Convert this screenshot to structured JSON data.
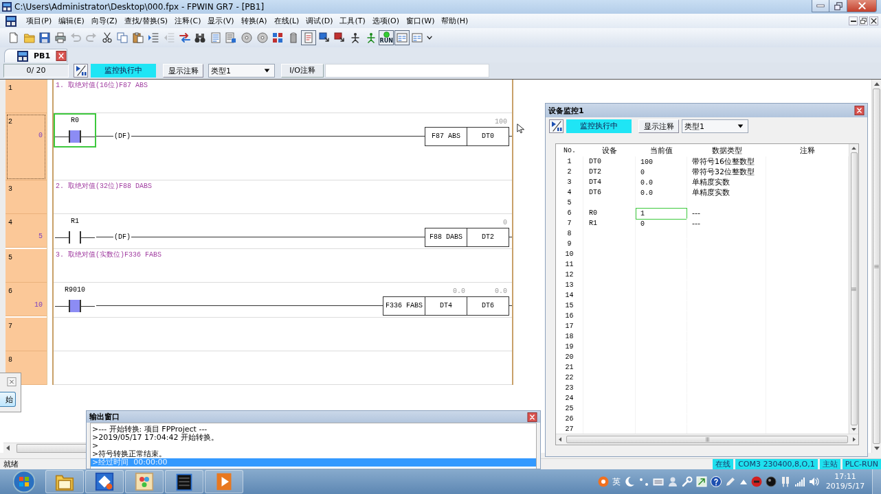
{
  "window": {
    "title": "C:\\Users\\Administrator\\Desktop\\000.fpx - FPWIN GR7 - [PB1]"
  },
  "menu": [
    "项目(P)",
    "编辑(E)",
    "向导(Z)",
    "查找/替换(S)",
    "注释(C)",
    "显示(V)",
    "转换(A)",
    "在线(L)",
    "调试(D)",
    "工具(T)",
    "选项(O)",
    "窗口(W)",
    "帮助(H)"
  ],
  "toolbar": [
    {
      "pressed": false,
      "disabled": false
    },
    {
      "pressed": false,
      "disabled": false
    },
    {
      "pressed": false,
      "disabled": false
    },
    {
      "pressed": false,
      "disabled": false
    },
    {
      "pressed": false,
      "disabled": true
    },
    {
      "pressed": false,
      "disabled": true
    },
    {
      "pressed": false,
      "disabled": false
    },
    {
      "pressed": false,
      "disabled": false
    },
    {
      "pressed": false,
      "disabled": false
    },
    {
      "pressed": false,
      "disabled": false
    },
    {
      "pressed": false,
      "disabled": true
    },
    {
      "pressed": false,
      "disabled": false
    },
    {
      "pressed": false,
      "disabled": false
    },
    {
      "pressed": false,
      "disabled": false
    },
    {
      "pressed": false,
      "disabled": false
    },
    {
      "pressed": false,
      "disabled": false
    },
    {
      "pressed": false,
      "disabled": false
    },
    {
      "pressed": false,
      "disabled": false
    },
    {
      "pressed": false,
      "disabled": false
    },
    {
      "pressed": true,
      "disabled": false
    },
    {
      "pressed": false,
      "disabled": false
    },
    {
      "pressed": false,
      "disabled": false
    },
    {
      "pressed": false,
      "disabled": false
    },
    {
      "pressed": false,
      "disabled": false
    },
    {
      "pressed": true,
      "disabled": false,
      "label": "RUN"
    },
    {
      "pressed": true,
      "disabled": false
    },
    {
      "pressed": false,
      "disabled": false
    }
  ],
  "document_tab": {
    "label": "PB1"
  },
  "program_bar": {
    "step_counter": "0/ 20",
    "monitor_status": "监控执行中",
    "comment_button": "显示注释",
    "type_select": "类型1",
    "io_label": "I/O注释"
  },
  "ladder": {
    "rows": [
      {
        "kind": "comment",
        "number": "1",
        "text": "1. 取绝对值(16位)F87 ABS",
        "selected": false
      },
      {
        "kind": "rung",
        "number": "2",
        "step": "0",
        "selected": true,
        "contact": {
          "device": "R0",
          "on": true,
          "selected": true
        },
        "edge": "(DF)",
        "cells": [
          {
            "text": "F87 ABS"
          },
          {
            "text": "DT0",
            "value": "100"
          }
        ]
      },
      {
        "kind": "comment",
        "number": "3",
        "text": "2. 取绝对值(32位)F88 DABS",
        "selected": false
      },
      {
        "kind": "rung",
        "number": "4",
        "step": "5",
        "selected": false,
        "contact": {
          "device": "R1",
          "on": false,
          "selected": false
        },
        "edge": "(DF)",
        "cells": [
          {
            "text": "F88 DABS"
          },
          {
            "text": "DT2",
            "value": "0"
          }
        ]
      },
      {
        "kind": "comment",
        "number": "5",
        "text": "3. 取绝对值(实数位)F336 FABS",
        "selected": false
      },
      {
        "kind": "rung",
        "number": "6",
        "step": "10",
        "selected": false,
        "contact": {
          "device": "R9010",
          "on": true,
          "selected": false
        },
        "cells": [
          {
            "text": "F336 FABS"
          },
          {
            "text": "DT4",
            "value": "0.0"
          },
          {
            "text": "DT6",
            "value": "0.0"
          }
        ]
      },
      {
        "kind": "empty",
        "number": "7",
        "selected": false
      },
      {
        "kind": "empty",
        "number": "8",
        "selected": false
      }
    ]
  },
  "device_monitor": {
    "title": "设备监控1",
    "status": "监控执行中",
    "comment_button": "显示注释",
    "type_select": "类型1",
    "columns": [
      "No.",
      "设备",
      "当前值",
      "数据类型",
      "注释"
    ],
    "rows": [
      {
        "no": "1",
        "device": "DT0",
        "value": "100",
        "data_type": "带符号16位整数型",
        "selected": false
      },
      {
        "no": "2",
        "device": "DT2",
        "value": "0",
        "data_type": "带符号32位整数型",
        "selected": false
      },
      {
        "no": "3",
        "device": "DT4",
        "value": "0.0",
        "data_type": "单精度实数",
        "selected": false
      },
      {
        "no": "4",
        "device": "DT6",
        "value": "0.0",
        "data_type": "单精度实数",
        "selected": false
      },
      {
        "no": "5",
        "selected": false
      },
      {
        "no": "6",
        "device": "R0",
        "value": "1",
        "data_type": "---",
        "selected": true
      },
      {
        "no": "7",
        "device": "R1",
        "value": "0",
        "data_type": "---",
        "selected": false
      },
      {
        "no": "8",
        "selected": false
      },
      {
        "no": "9",
        "selected": false
      },
      {
        "no": "10",
        "selected": false
      },
      {
        "no": "11",
        "selected": false
      },
      {
        "no": "12",
        "selected": false
      },
      {
        "no": "13",
        "selected": false
      },
      {
        "no": "14",
        "selected": false
      },
      {
        "no": "15",
        "selected": false
      },
      {
        "no": "16",
        "selected": false
      },
      {
        "no": "17",
        "selected": false
      },
      {
        "no": "18",
        "selected": false
      },
      {
        "no": "19",
        "selected": false
      },
      {
        "no": "20",
        "selected": false
      },
      {
        "no": "21",
        "selected": false
      },
      {
        "no": "22",
        "selected": false
      },
      {
        "no": "23",
        "selected": false
      },
      {
        "no": "24",
        "selected": false
      },
      {
        "no": "25",
        "selected": false
      },
      {
        "no": "26",
        "selected": false
      },
      {
        "no": "27",
        "selected": false
      }
    ]
  },
  "output": {
    "title": "输出窗口",
    "lines": [
      {
        "text": ">--- 开始转换: 项目 FPProject ---",
        "selected": false
      },
      {
        "text": ">2019/05/17 17:04:42 开始转换。",
        "selected": false
      },
      {
        "text": ">",
        "selected": false
      },
      {
        "text": ">符号转换正常结束。",
        "selected": false
      },
      {
        "text": ">经过时间  00:00:00",
        "selected": true
      }
    ]
  },
  "side_dialog": {
    "button": "始"
  },
  "status_bar": {
    "text": "就绪",
    "indicators": [
      "在线",
      "COM3 230400,8,O,1",
      "主站",
      "PLC-RUN"
    ]
  },
  "taskbar": {
    "ime": "英",
    "time": "17:11",
    "date": "2019/5/17"
  }
}
